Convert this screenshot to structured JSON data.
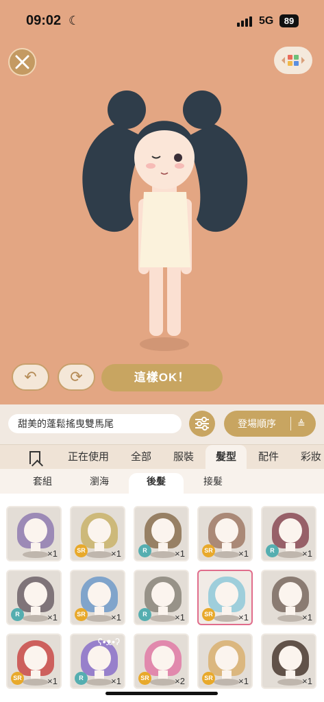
{
  "status_bar": {
    "time": "09:02",
    "network": "5G",
    "battery": "89"
  },
  "actions": {
    "ok_label": "這樣OK！"
  },
  "toolbar": {
    "item_name": "甜美的蓬鬆搖曳雙馬尾",
    "sort_label": "登場順序"
  },
  "category_tabs": [
    "正在使用",
    "全部",
    "服裝",
    "髮型",
    "配件",
    "彩妝"
  ],
  "sub_tabs": [
    "套組",
    "瀏海",
    "後髮",
    "接髮"
  ],
  "items": [
    {
      "rarity": "",
      "count": "×1",
      "hair": "#8f7bb0"
    },
    {
      "rarity": "SR",
      "count": "×1",
      "hair": "#c9b36a"
    },
    {
      "rarity": "R",
      "count": "×1",
      "hair": "#8a7050"
    },
    {
      "rarity": "SR",
      "count": "×1",
      "hair": "#a07a66"
    },
    {
      "rarity": "R",
      "count": "×1",
      "hair": "#8a4a55"
    },
    {
      "rarity": "R",
      "count": "×1",
      "hair": "#6d6268"
    },
    {
      "rarity": "SR",
      "count": "×1",
      "hair": "#6f9ac9"
    },
    {
      "rarity": "R",
      "count": "×1",
      "hair": "#8a857a"
    },
    {
      "rarity": "SR",
      "count": "×1",
      "hair": "#8fc9d8"
    },
    {
      "rarity": "",
      "count": "×1",
      "hair": "#7a6a60"
    },
    {
      "rarity": "SR",
      "count": "×1",
      "hair": "#c94a48"
    },
    {
      "rarity": "R",
      "count": "×1",
      "hair": "#8a70c9"
    },
    {
      "rarity": "SR",
      "count": "×2",
      "hair": "#e07aa6"
    },
    {
      "rarity": "SR",
      "count": "×1",
      "hair": "#d9b070"
    },
    {
      "rarity": "",
      "count": "×1",
      "hair": "#4a3a30"
    }
  ]
}
